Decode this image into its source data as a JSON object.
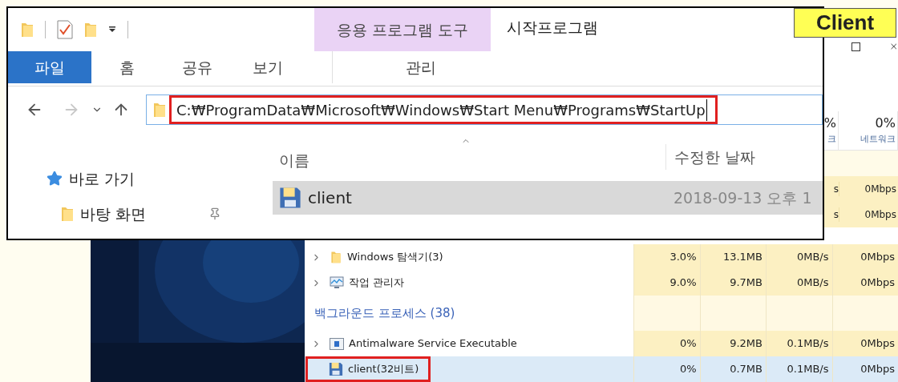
{
  "label": "Client",
  "explorer": {
    "contextual_tab_group": "응용 프로그램 도구",
    "title": "시작프로그램",
    "ribbon_tabs": [
      {
        "label": "파일",
        "selected": true
      },
      {
        "label": "홈",
        "selected": false
      },
      {
        "label": "공유",
        "selected": false
      },
      {
        "label": "보기",
        "selected": false
      },
      {
        "label": "관리",
        "selected": false
      }
    ],
    "address": {
      "value": "C:₩ProgramData₩Microsoft₩Windows₩Start Menu₩Programs₩StartUp",
      "highlighted": true
    },
    "nav_pane": [
      {
        "label": "바로 가기",
        "kind": "quick"
      },
      {
        "label": "바탕 화면",
        "kind": "desktop"
      }
    ],
    "columns": [
      "이름",
      "수정한 날짜"
    ],
    "files": [
      {
        "name": "client",
        "modified": "2018-09-13 오후 1",
        "selected": true
      }
    ]
  },
  "task_manager": {
    "columns": [
      {
        "usage": "%",
        "label": "크"
      },
      {
        "usage": "0%",
        "label": "네트워크"
      }
    ],
    "upper_rows": [
      {
        "disk": "s",
        "network": "0Mbps"
      },
      {
        "disk": "s",
        "network": "0Mbps"
      }
    ],
    "rows": [
      {
        "kind": "app",
        "name": "Windows 탐색기(3)",
        "expandable": true,
        "selected": false,
        "highlighted": false,
        "cpu": "3.0%",
        "memory": "13.1MB",
        "disk": "0MB/s",
        "network": "0Mbps"
      },
      {
        "kind": "app",
        "name": "작업 관리자",
        "expandable": true,
        "selected": false,
        "highlighted": false,
        "cpu": "9.0%",
        "memory": "9.7MB",
        "disk": "0MB/s",
        "network": "0Mbps"
      },
      {
        "kind": "section",
        "name": "백그라운드 프로세스 (38)"
      },
      {
        "kind": "app",
        "name": "Antimalware Service Executable",
        "expandable": true,
        "selected": false,
        "highlighted": false,
        "cpu": "0%",
        "memory": "9.2MB",
        "disk": "0.1MB/s",
        "network": "0Mbps"
      },
      {
        "kind": "app",
        "name": "client(32비트)",
        "expandable": false,
        "selected": true,
        "highlighted": true,
        "cpu": "0%",
        "memory": "0.7MB",
        "disk": "0.1MB/s",
        "network": "0Mbps"
      }
    ]
  }
}
